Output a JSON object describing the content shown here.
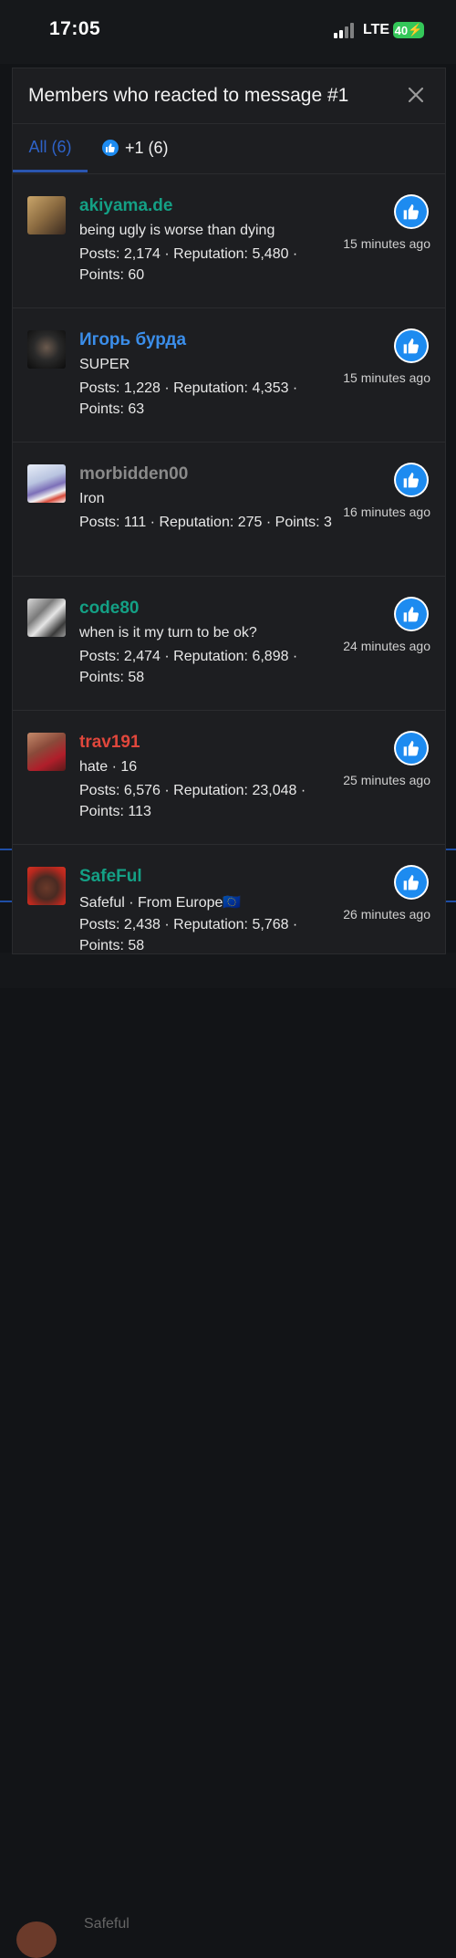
{
  "status": {
    "time": "17:05",
    "network": "LTE",
    "battery": "40"
  },
  "backdrop": {
    "snippet": "Safeful"
  },
  "modal": {
    "title": "Members who reacted to message #1",
    "tabs": [
      {
        "label": "All (6)"
      },
      {
        "label": "+1 (6)"
      }
    ]
  },
  "colors": {
    "accent": "#2e63c9",
    "like": "#1d8bf0"
  },
  "members": [
    {
      "name": "akiyama.de",
      "name_color": "#14a085",
      "title": "being ugly is worse than dying",
      "stats": "Posts: 2,174 · Reputation: 5,480 · Points: 60",
      "time": "15 minutes ago"
    },
    {
      "name": "Игорь бурда",
      "name_color": "#3b8eea",
      "title": "SUPER",
      "stats": "Posts: 1,228 · Reputation: 4,353 · Points: 63",
      "time": "15 minutes ago"
    },
    {
      "name": "morbidden00",
      "name_color": "#8a8a8a",
      "title": "Iron",
      "stats": "Posts: 111 · Reputation: 275 · Points: 3",
      "time": "16 minutes ago"
    },
    {
      "name": "code80",
      "name_color": "#14a085",
      "title": "when is it my turn to be ok?",
      "stats": "Posts: 2,474 · Reputation: 6,898 · Points: 58",
      "time": "24 minutes ago"
    },
    {
      "name": "trav191",
      "name_color": "#e0473c",
      "title": "hate · 16",
      "stats": "Posts: 6,576 · Reputation: 23,048 · Points: 113",
      "time": "25 minutes ago"
    },
    {
      "name": "SafeFul",
      "name_color": "#14a085",
      "title": "Safeful · From Europe🇪🇺",
      "stats": "Posts: 2,438 · Reputation: 5,768 · Points: 58",
      "time": "26 minutes ago"
    }
  ]
}
